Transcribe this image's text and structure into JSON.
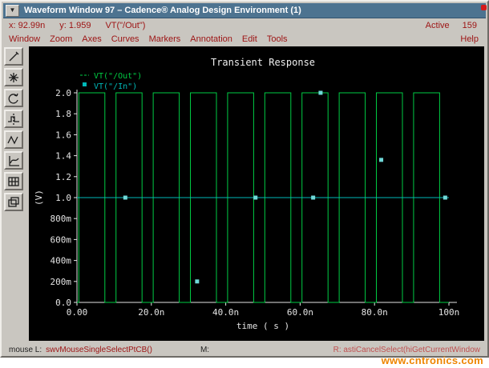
{
  "window": {
    "title": "Waveform Window 97 – Cadence® Analog Design Environment (1)"
  },
  "status": {
    "x_label": "x:",
    "x_value": "92.99n",
    "y_label": "y:",
    "y_value": "1.959",
    "trace_ref": "VT(\"/Out\")",
    "active_label": "Active",
    "active_count": "159"
  },
  "menu": {
    "items": [
      "Window",
      "Zoom",
      "Axes",
      "Curves",
      "Markers",
      "Annotation",
      "Edit",
      "Tools"
    ],
    "help": "Help"
  },
  "toolbar": {
    "icons": [
      "probe-pen-icon",
      "burst-zoom-icon",
      "rotate-arc-icon",
      "pulse-marker-icon",
      "zigzag-trace-icon",
      "subplot-axes-icon",
      "table-grid-icon",
      "overlay-windows-icon"
    ]
  },
  "footer": {
    "mouse_l_label": "mouse L:",
    "mouse_l_command": "swvMouseSingleSelectPtCB()",
    "middle_label": "M:",
    "right_status": "R: astiCancelSelect(hiGetCurrentWindow"
  },
  "watermark": "www.cntronics.com",
  "chart_data": {
    "type": "line",
    "title": "Transient Response",
    "xlabel": "time ( s )",
    "ylabel": "(V)",
    "x_unit": "ns",
    "xlim": [
      0,
      100
    ],
    "ylim": [
      0,
      2.0
    ],
    "grid": false,
    "background": "#000000",
    "axis_color": "#e4e4e4",
    "legend_position": "top-left",
    "xticks": [
      {
        "t": 0,
        "label": "0.00"
      },
      {
        "t": 20,
        "label": "20.0n"
      },
      {
        "t": 40,
        "label": "40.0n"
      },
      {
        "t": 60,
        "label": "60.0n"
      },
      {
        "t": 80,
        "label": "80.0n"
      },
      {
        "t": 100,
        "label": "100n"
      }
    ],
    "yticks": [
      {
        "v": 2.0,
        "label": "2.0"
      },
      {
        "v": 1.8,
        "label": "1.8"
      },
      {
        "v": 1.6,
        "label": "1.6"
      },
      {
        "v": 1.4,
        "label": "1.4"
      },
      {
        "v": 1.2,
        "label": "1.2"
      },
      {
        "v": 1.0,
        "label": "1.0"
      },
      {
        "v": 0.8,
        "label": "800m"
      },
      {
        "v": 0.6,
        "label": "600m"
      },
      {
        "v": 0.4,
        "label": "400m"
      },
      {
        "v": 0.2,
        "label": "200m"
      },
      {
        "v": 0.0,
        "label": "0.0"
      }
    ],
    "series": [
      {
        "name": "VT(\"/Out\")",
        "color": "#00cc44",
        "shape": "square_wave",
        "t_start": 0,
        "t_end": 100,
        "period": 10,
        "t_rise": 0.5,
        "t_fall": 7.5,
        "low": 0.0,
        "high": 2.0
      },
      {
        "name": "VT(\"/In\")",
        "color": "#00b8b8",
        "shape": "constant",
        "t_start": 0,
        "t_end": 100,
        "value": 1.0
      }
    ],
    "markers": {
      "color": "#6fd8d8",
      "points": [
        [
          13,
          1.0
        ],
        [
          32.3,
          0.2
        ],
        [
          48,
          1.0
        ],
        [
          63.5,
          1.0
        ],
        [
          65.5,
          2.0
        ],
        [
          81.8,
          1.36
        ],
        [
          99,
          1.0
        ]
      ]
    }
  }
}
